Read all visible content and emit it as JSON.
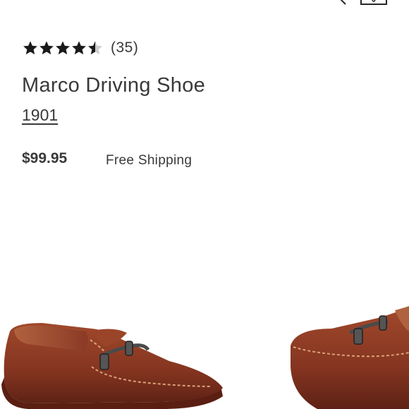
{
  "header": {
    "menu_icon": "hamburger-menu-icon",
    "search_icon": "search-icon",
    "bag_icon": "shopping-bag-icon"
  },
  "product": {
    "rating": 4.5,
    "rating_max": 5,
    "review_count": "(35)",
    "name": "Marco Driving Shoe",
    "brand": "1901",
    "price": "$99.95",
    "shipping": "Free Shipping"
  },
  "colors": {
    "text": "#393939",
    "star": "#1a1a1a",
    "star_empty": "#cccccc",
    "leather": "#8a3a25"
  }
}
